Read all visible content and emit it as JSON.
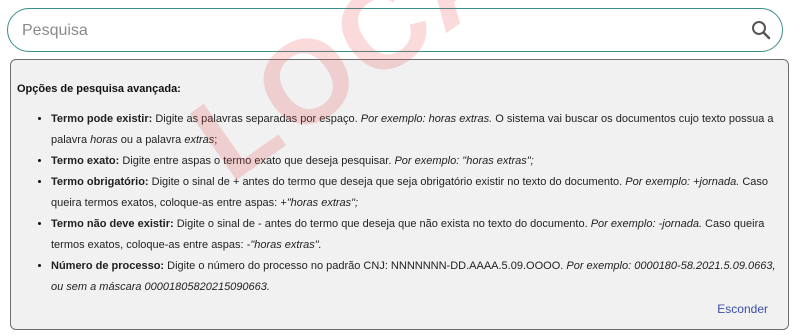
{
  "search": {
    "placeholder": "Pesquisa",
    "value": "",
    "icon": "search-icon"
  },
  "watermark": "LOCAL",
  "advanced": {
    "title": "Opções de pesquisa avançada:",
    "items": [
      {
        "term": "Termo pode existir:",
        "desc": " Digite as palavras separadas por espaço. ",
        "example": "Por exemplo: horas extras.",
        "desc2": " O sistema vai buscar os documentos cujo texto possua a palavra ",
        "w1": "horas",
        "desc3": " ou a palavra ",
        "w2": "extras",
        "end": ";"
      },
      {
        "term": "Termo exato:",
        "desc": " Digite entre aspas o termo exato que deseja pesquisar. ",
        "example": "Por exemplo: \"horas extras\";"
      },
      {
        "term": "Termo obrigatório:",
        "desc": " Digite o sinal de + antes do termo que deseja que seja obrigatório existir no texto do documento. ",
        "example": "Por exemplo: +jornada.",
        "desc2": " Caso queira termos exatos, coloque-as entre aspas: ",
        "example2": "+\"horas extras\";"
      },
      {
        "term": "Termo não deve existir:",
        "desc": " Digite o sinal de - antes do termo que deseja que não exista no texto do documento. ",
        "example": "Por exemplo: -jornada.",
        "desc2": " Caso queira termos exatos, coloque-as entre aspas: ",
        "example2": "-\"horas extras\"."
      },
      {
        "term": "Número de processo:",
        "desc": " Digite o número do processo no padrão CNJ: NNNNNNN-DD.AAAA.5.09.OOOO. ",
        "example": "Por exemplo: 0000180-58.2021.5.09.0663, ou sem a máscara 00001805820215090663."
      }
    ],
    "hide_label": "Esconder"
  },
  "colors": {
    "search_border": "#3a8d8b",
    "panel_bg": "#f1f1f1",
    "link": "#3a4fa8",
    "watermark": "#e64646"
  }
}
